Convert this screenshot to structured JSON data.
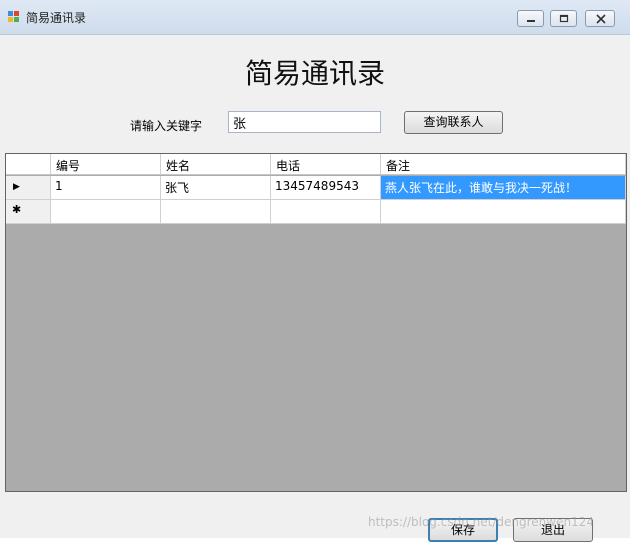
{
  "window": {
    "title": "简易通讯录",
    "controls": [
      "minimize-icon",
      "maximize-icon",
      "close-icon"
    ]
  },
  "form": {
    "heading": "简易通讯录",
    "keyword_label": "请输入关键字",
    "keyword_value": "张",
    "search_button": "查询联系人"
  },
  "grid": {
    "columns": [
      "编号",
      "姓名",
      "电话",
      "备注"
    ],
    "rows": [
      {
        "indicator": "▶",
        "cells": [
          "1",
          "张飞",
          "13457489543",
          "燕人张飞在此，谁敢与我决一死战！"
        ]
      },
      {
        "indicator": "✱",
        "cells": [
          "",
          "",
          "",
          ""
        ]
      }
    ]
  },
  "footer": {
    "save_button": "保存",
    "exit_button": "退出",
    "watermark": "https://blog.csdn.net/dengrenwen124"
  },
  "colors": {
    "selection": "#3399ff",
    "empty_area": "#ababab"
  }
}
